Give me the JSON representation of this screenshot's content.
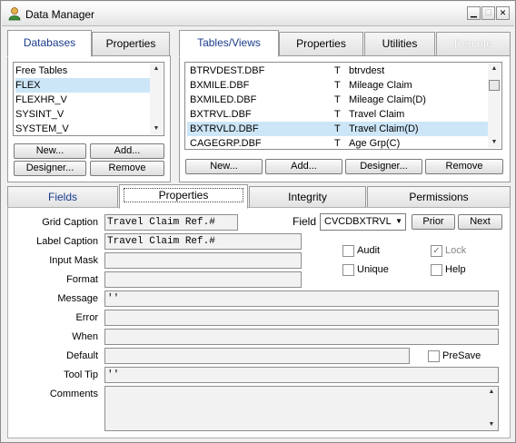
{
  "window": {
    "title": "Data Manager"
  },
  "left_tabs": {
    "databases": "Databases",
    "properties": "Properties"
  },
  "databases": [
    "Free Tables",
    "FLEX",
    "FLEXHR_V",
    "SYSINT_V",
    "SYSTEM_V"
  ],
  "left_buttons": {
    "new": "New...",
    "add": "Add...",
    "designer": "Designer...",
    "remove": "Remove"
  },
  "right_tabs": {
    "tables_views": "Tables/Views",
    "properties": "Properties",
    "utilities": "Utilities",
    "remote": "Remote"
  },
  "tables": [
    {
      "file": "BTRVDEST.DBF",
      "type": "T",
      "desc": "btrvdest"
    },
    {
      "file": "BXMILE.DBF",
      "type": "T",
      "desc": "Mileage Claim"
    },
    {
      "file": "BXMILED.DBF",
      "type": "T",
      "desc": "Mileage Claim(D)"
    },
    {
      "file": "BXTRVL.DBF",
      "type": "T",
      "desc": "Travel Claim"
    },
    {
      "file": "BXTRVLD.DBF",
      "type": "T",
      "desc": "Travel Claim(D)"
    },
    {
      "file": "CAGEGRP.DBF",
      "type": "T",
      "desc": "Age Grp(C)"
    }
  ],
  "right_buttons": {
    "new": "New...",
    "add": "Add...",
    "designer": "Designer...",
    "remove": "Remove"
  },
  "bottom_tabs": {
    "fields": "Fields",
    "properties": "Properties",
    "integrity": "Integrity",
    "permissions": "Permissions"
  },
  "props": {
    "grid_caption_label": "Grid Caption",
    "grid_caption": "Travel Claim Ref.#",
    "label_caption_label": "Label Caption",
    "label_caption": "Travel Claim Ref.#",
    "input_mask_label": "Input Mask",
    "input_mask": "",
    "format_label": "Format",
    "format": "",
    "message_label": "Message",
    "message": "''",
    "error_label": "Error",
    "error": "",
    "when_label": "When",
    "when": "",
    "default_label": "Default",
    "default": "",
    "tooltip_label": "Tool Tip",
    "tooltip": "''",
    "comments_label": "Comments",
    "comments": ""
  },
  "field_selector": {
    "label": "Field",
    "value": "CVCDBXTRVL",
    "prior": "Prior",
    "next": "Next"
  },
  "checks": {
    "audit": {
      "label": "Audit",
      "checked": false
    },
    "lock": {
      "label": "Lock",
      "checked": true
    },
    "unique": {
      "label": "Unique",
      "checked": false
    },
    "help": {
      "label": "Help",
      "checked": false
    },
    "presave": {
      "label": "PreSave",
      "checked": false
    }
  }
}
